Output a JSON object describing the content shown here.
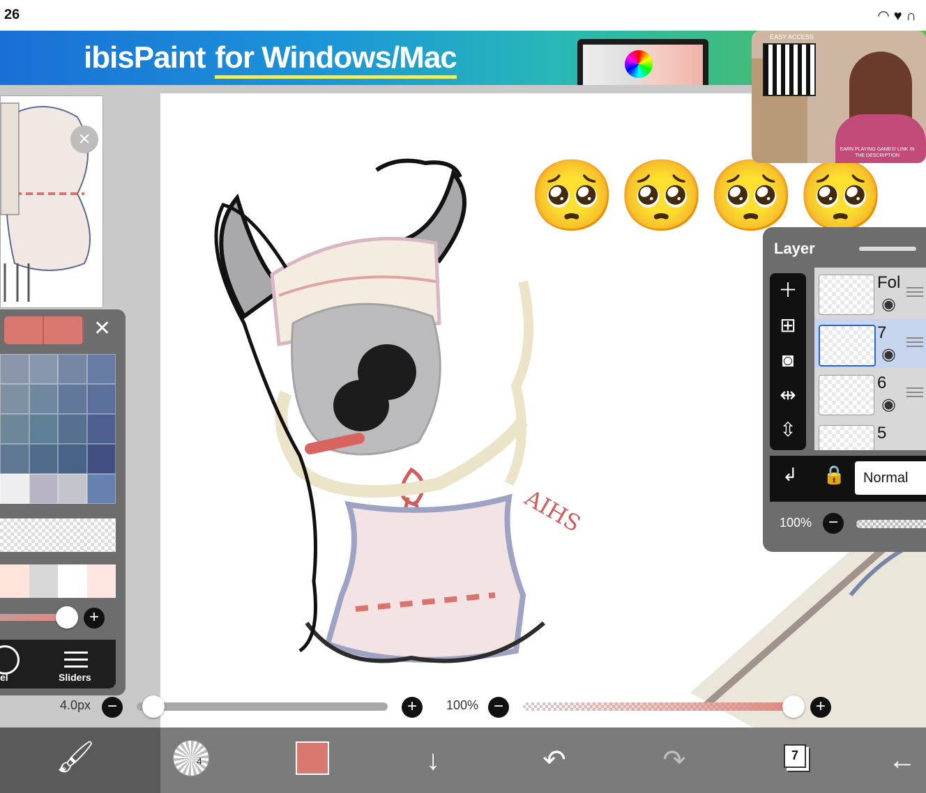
{
  "status_bar": {
    "time": "26",
    "icons": [
      "wifi-icon",
      "heart-icon",
      "headphones-icon"
    ]
  },
  "ad": {
    "brand": "ibisPaint",
    "tagline": "for Windows/Mac",
    "video": {
      "easy_access": "EASY ACCESS",
      "caption": "EARN PLAYING GAMES! LINK IN THE DESCRIPTION"
    }
  },
  "canvas": {
    "emoji": "🥺🥺🥺🥺",
    "signature": "AIHS"
  },
  "color_panel": {
    "tabs": [
      {
        "label": "el",
        "icon": "color-wheel-icon"
      },
      {
        "label": "Sliders",
        "icon": "sliders-icon"
      }
    ],
    "palette_colors": [
      "#8b96ab",
      "#8797ad",
      "#7587a3",
      "#687da6",
      "#7c90a2",
      "#6f889f",
      "#61789a",
      "#5b6f9d",
      "#6c8898",
      "#5f7f96",
      "#56708f",
      "#4d5f8f",
      "#5d7890",
      "#4f6d8b",
      "#476386",
      "#404f80",
      "#eeeef0",
      "#b8b4c4",
      "#c4c4cc",
      "#6480ad"
    ],
    "row2_colors": [
      "#ffe4dc",
      "#d8d8d8",
      "#ffffff",
      "#ffe6e0"
    ]
  },
  "layer_panel": {
    "title": "Layer",
    "layers": [
      {
        "name": "Fol",
        "selected": false
      },
      {
        "name": "7",
        "selected": true
      },
      {
        "name": "6",
        "selected": false
      },
      {
        "name": "5",
        "selected": false
      }
    ],
    "blend_mode": "Normal",
    "opacity": "100%"
  },
  "brush_bar": {
    "size": "4.0px",
    "opacity": "100%"
  },
  "toolbar": {
    "brush_size_badge": "4",
    "layer_count": "7",
    "accent": "#d97870"
  }
}
